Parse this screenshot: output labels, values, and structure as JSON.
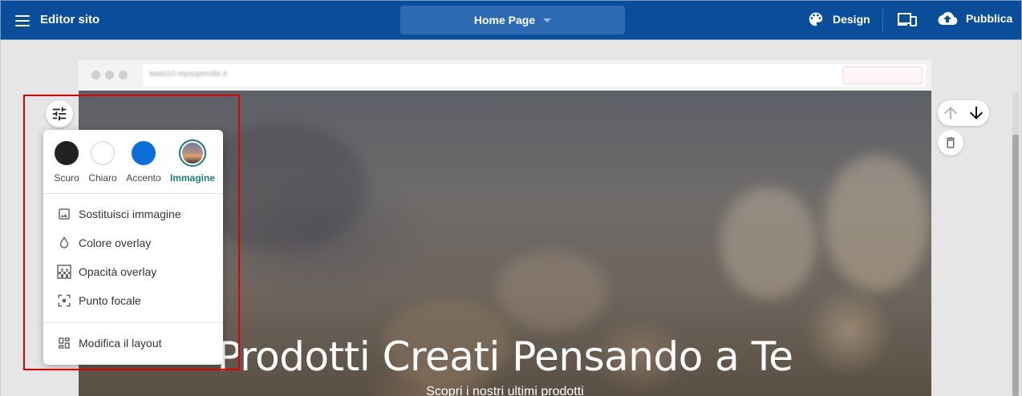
{
  "topbar": {
    "title": "Editor sito",
    "page_selector": "Home Page",
    "design_label": "Design",
    "publish_label": "Pubblica"
  },
  "browser": {
    "url": "tasto10.mysupersite.it"
  },
  "hero": {
    "title": "Prodotti Creati Pensando a Te",
    "subtitle": "Scopri i nostri ultimi prodotti"
  },
  "panel": {
    "swatches": [
      {
        "label": "Scuro",
        "color": "#222222"
      },
      {
        "label": "Chiaro",
        "color": "#ffffff"
      },
      {
        "label": "Accento",
        "color": "#0b6fd9"
      },
      {
        "label": "Immagine",
        "color": "#1a7d78",
        "selected": true
      }
    ],
    "items": [
      {
        "label": "Sostituisci immagine",
        "icon": "image-icon"
      },
      {
        "label": "Colore overlay",
        "icon": "drop-icon"
      },
      {
        "label": "Opacità overlay",
        "icon": "opacity-icon"
      },
      {
        "label": "Punto focale",
        "icon": "focal-point-icon"
      },
      {
        "label": "Modifica il layout",
        "icon": "layout-icon"
      }
    ]
  },
  "colors": {
    "topbar": "#0a4e9b",
    "accent_selected": "#1a7d78",
    "highlight": "#e00000"
  }
}
